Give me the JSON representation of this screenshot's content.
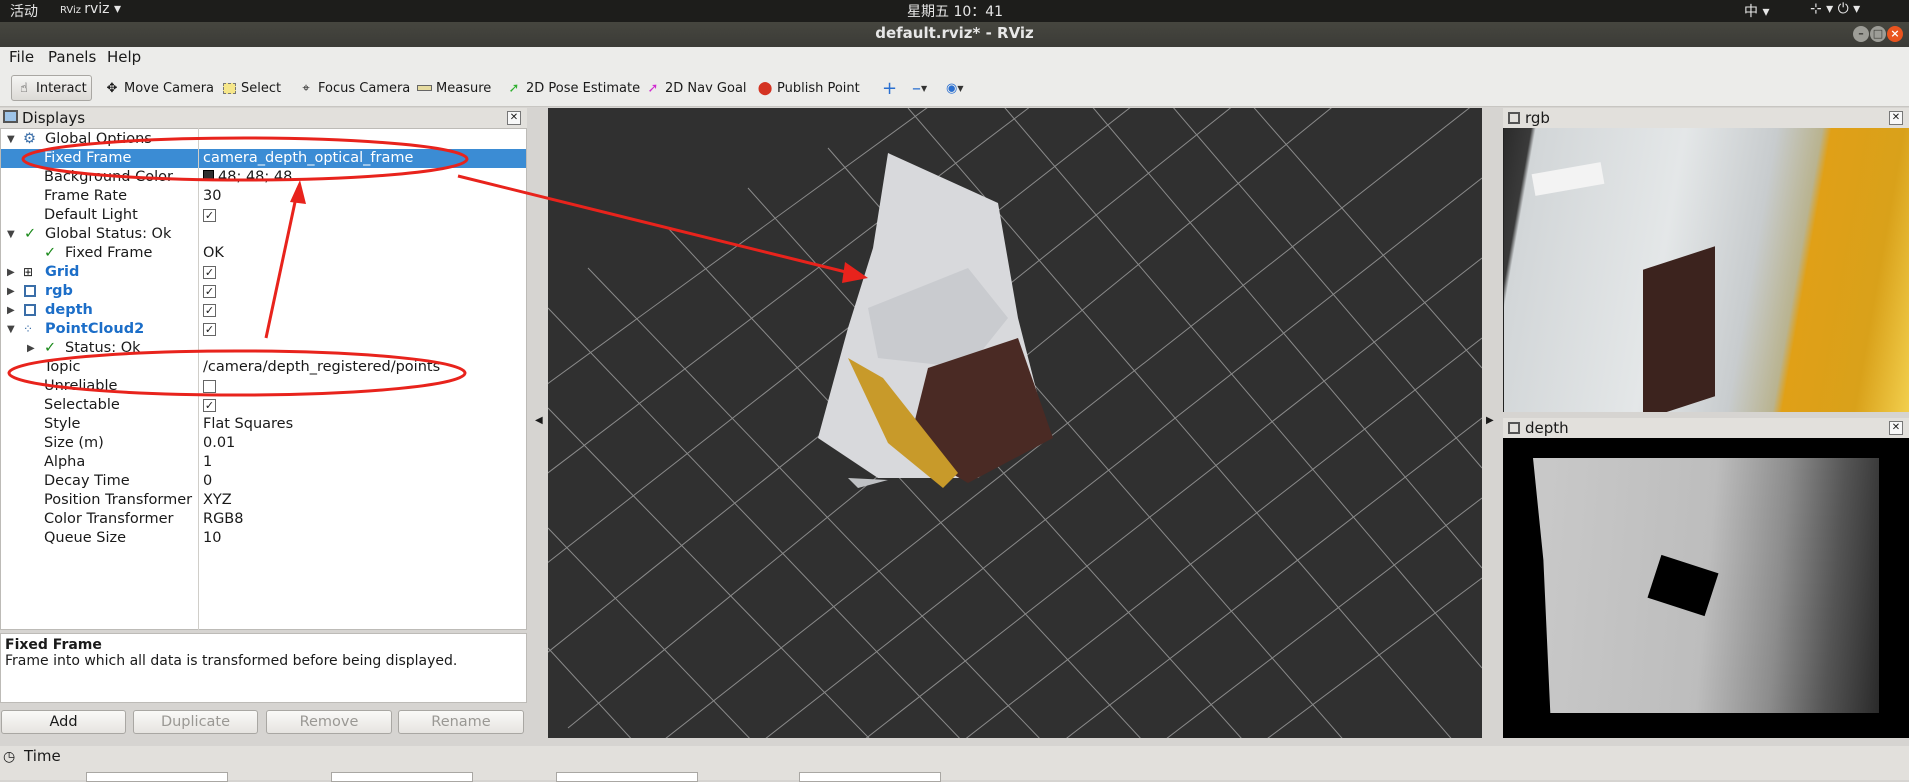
{
  "topbar": {
    "activities": "活动",
    "app": "rviz ▾",
    "clock": "星期五 10：41",
    "ime": "中 ▾",
    "sys_icons": "⊹ ▾   ⏻ ▾"
  },
  "window": {
    "title": "default.rviz* - RViz"
  },
  "menu": {
    "file": "File",
    "panels": "Panels",
    "help": "Help"
  },
  "toolbar": {
    "interact": "Interact",
    "move_camera": "Move Camera",
    "select": "Select",
    "focus_camera": "Focus Camera",
    "measure": "Measure",
    "pose_estimate": "2D Pose Estimate",
    "nav_goal": "2D Nav Goal",
    "publish_point": "Publish Point"
  },
  "displays": {
    "title": "Displays",
    "rows": [
      {
        "name": "Global Options",
        "value": ""
      },
      {
        "name": "Fixed Frame",
        "value": "camera_depth_optical_frame"
      },
      {
        "name": "Background Color",
        "value": "48; 48; 48"
      },
      {
        "name": "Frame Rate",
        "value": "30"
      },
      {
        "name": "Default Light",
        "value": "✓"
      },
      {
        "name": "Global Status: Ok",
        "value": ""
      },
      {
        "name": "Fixed Frame",
        "value": "OK"
      },
      {
        "name": "Grid",
        "value": "✓"
      },
      {
        "name": "rgb",
        "value": "✓"
      },
      {
        "name": "depth",
        "value": "✓"
      },
      {
        "name": "PointCloud2",
        "value": "✓"
      },
      {
        "name": "Status: Ok",
        "value": ""
      },
      {
        "name": "Topic",
        "value": "/camera/depth_registered/points"
      },
      {
        "name": "Unreliable",
        "value": ""
      },
      {
        "name": "Selectable",
        "value": "✓"
      },
      {
        "name": "Style",
        "value": "Flat Squares"
      },
      {
        "name": "Size (m)",
        "value": "0.01"
      },
      {
        "name": "Alpha",
        "value": "1"
      },
      {
        "name": "Decay Time",
        "value": "0"
      },
      {
        "name": "Position Transformer",
        "value": "XYZ"
      },
      {
        "name": "Color Transformer",
        "value": "RGB8"
      },
      {
        "name": "Queue Size",
        "value": "10"
      }
    ]
  },
  "description": {
    "title": "Fixed Frame",
    "text": "Frame into which all data is transformed before being displayed."
  },
  "buttons": {
    "add": "Add",
    "duplicate": "Duplicate",
    "remove": "Remove",
    "rename": "Rename"
  },
  "panels": {
    "rgb": "rgb",
    "depth": "depth"
  },
  "time": {
    "title": "Time"
  },
  "colors": {
    "selection": "#3b8cd4",
    "view_bg": "#303030",
    "annotation": "#e8231c"
  }
}
